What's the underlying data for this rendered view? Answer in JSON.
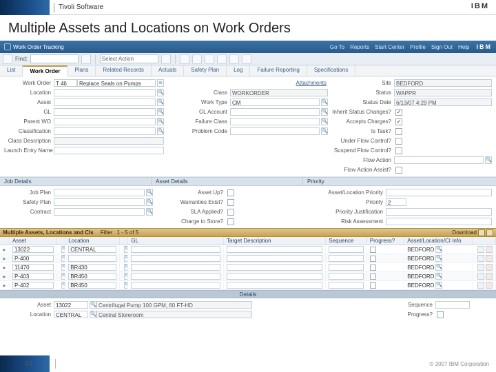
{
  "brand": {
    "product": "Tivoli Software",
    "company": "IBM"
  },
  "title": "Multiple Assets and Locations on Work Orders",
  "header": {
    "app_name": "Work Order Tracking",
    "links": {
      "goto": "Go To",
      "reports": "Reports",
      "start": "Start Center",
      "profile": "Profile",
      "signout": "Sign Out",
      "help": "Help"
    },
    "ibm": "IBM"
  },
  "toolbar": {
    "find_label": "Find:",
    "find_value": "",
    "select_action": "Select Action"
  },
  "tabs": [
    "List",
    "Work Order",
    "Plans",
    "Related Records",
    "Actuals",
    "Safety Plan",
    "Log",
    "Failure Reporting",
    "Specifications"
  ],
  "active_tab": 1,
  "attachments_label": "Attachments",
  "form": {
    "col1": {
      "work_order": {
        "label": "Work Order",
        "value": "T 46",
        "desc": "Replace Seals on Pumps"
      },
      "location": {
        "label": "Location",
        "value": ""
      },
      "asset": {
        "label": "Asset",
        "value": ""
      },
      "gl": {
        "label": "GL",
        "value": ""
      },
      "parent_wo": {
        "label": "Parent WO",
        "value": ""
      },
      "classification": {
        "label": "Classification",
        "value": ""
      },
      "class_desc": {
        "label": "Class Description",
        "value": ""
      },
      "launch": {
        "label": "Launch Entry Name",
        "value": ""
      }
    },
    "col3": {
      "class": {
        "label": "Class",
        "value": "WORKORDER"
      },
      "wotype": {
        "label": "Work Type",
        "value": "CM"
      },
      "glacct": {
        "label": "GL Account",
        "value": ""
      },
      "failclass": {
        "label": "Failure Class",
        "value": ""
      },
      "probcode": {
        "label": "Problem Code",
        "value": ""
      }
    },
    "col4": {
      "site": {
        "label": "Site",
        "value": "BEDFORD"
      },
      "status": {
        "label": "Status",
        "value": "WAPPR"
      },
      "status_date": {
        "label": "Status Date",
        "value": "6/13/07 4:29 PM"
      },
      "inherit": {
        "label": "Inherit Status Changes?",
        "checked": true
      },
      "accepts": {
        "label": "Accepts Charges?",
        "checked": true
      },
      "istask": {
        "label": "Is Task?",
        "checked": false
      },
      "underflow": {
        "label": "Under Flow Control?",
        "checked": false
      },
      "suspend": {
        "label": "Suspend Flow Control?",
        "checked": false
      },
      "flowaction": {
        "label": "Flow Action",
        "value": ""
      },
      "flowassist": {
        "label": "Flow Action Assist?",
        "checked": false
      }
    }
  },
  "bands": {
    "job": "Job Details",
    "asset": "Asset Details",
    "priority": "Priority"
  },
  "job": {
    "jobplan": {
      "label": "Job Plan",
      "value": ""
    },
    "safetyplan": {
      "label": "Safety Plan",
      "value": ""
    },
    "contract": {
      "label": "Contract",
      "value": ""
    }
  },
  "assetdet": {
    "assetup": {
      "label": "Asset Up?",
      "checked": false
    },
    "warranties": {
      "label": "Warranties Exist?",
      "checked": false
    },
    "sla": {
      "label": "SLA Applied?",
      "checked": false
    },
    "charge": {
      "label": "Charge to Store?",
      "checked": false
    }
  },
  "priority": {
    "alp": {
      "label": "Asset/Location Priority",
      "value": ""
    },
    "pri": {
      "label": "Priority",
      "value": "2"
    },
    "just": {
      "label": "Priority Justification",
      "value": ""
    },
    "risk": {
      "label": "Risk Assessment",
      "value": ""
    }
  },
  "multi": {
    "title": "Multiple Assets, Locations and CIs",
    "filter": "Filter",
    "range": "1 - 5 of 5",
    "download": "Download"
  },
  "thead": {
    "asset": "Asset",
    "location": "Location",
    "gl": "GL",
    "target": "Target Description",
    "sequence": "Sequence",
    "progress": "Progress?",
    "assetloc": "Asset/Location/CI Info"
  },
  "rows": [
    {
      "asset": "13022",
      "location": "CENTRAL",
      "gl": "",
      "target": "",
      "seq": "",
      "prog": false,
      "info": "BEDFORD"
    },
    {
      "asset": "P-400",
      "location": "",
      "gl": "",
      "target": "",
      "seq": "",
      "prog": false,
      "info": "BEDFORD"
    },
    {
      "asset": "11470",
      "location": "BR430",
      "gl": "",
      "target": "",
      "seq": "",
      "prog": false,
      "info": "BEDFORD"
    },
    {
      "asset": "P-403",
      "location": "BR450",
      "gl": "",
      "target": "",
      "seq": "",
      "prog": false,
      "info": "BEDFORD"
    },
    {
      "asset": "P-402",
      "location": "BR450",
      "gl": "",
      "target": "",
      "seq": "",
      "prog": false,
      "info": "BEDFORD"
    }
  ],
  "details_band": "Details",
  "details": {
    "asset": {
      "label": "Asset",
      "value": "13022",
      "desc": "Centrifugal Pump 100 GPM, 60 FT-HD"
    },
    "location": {
      "label": "Location",
      "value": "CENTRAL",
      "desc": "Central Storeroom"
    },
    "sequence": {
      "label": "Sequence",
      "value": ""
    },
    "progress": {
      "label": "Progress?",
      "checked": false
    }
  },
  "footer": {
    "page": "43",
    "copyright": "© 2007 IBM Corporation"
  }
}
